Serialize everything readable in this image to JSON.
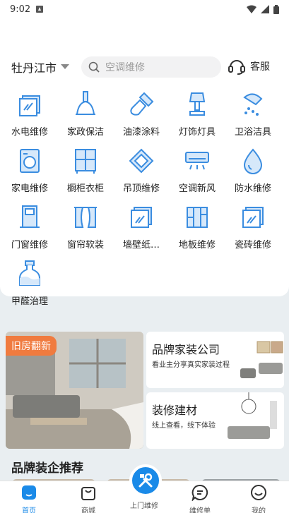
{
  "status": {
    "time": "9:02"
  },
  "header": {
    "city": "牡丹江市",
    "search_placeholder": "空调维修",
    "service_label": "客服"
  },
  "categories": [
    {
      "label": "水电维修",
      "icon": "water-electric-icon"
    },
    {
      "label": "家政保洁",
      "icon": "cleaning-icon"
    },
    {
      "label": "油漆涂料",
      "icon": "paint-brush-icon"
    },
    {
      "label": "灯饰灯具",
      "icon": "lamp-icon"
    },
    {
      "label": "卫浴洁具",
      "icon": "shower-icon"
    },
    {
      "label": "家电维修",
      "icon": "washing-machine-icon"
    },
    {
      "label": "橱柜衣柜",
      "icon": "wardrobe-icon"
    },
    {
      "label": "吊顶维修",
      "icon": "ceiling-icon"
    },
    {
      "label": "空调新风",
      "icon": "air-conditioner-icon"
    },
    {
      "label": "防水维修",
      "icon": "water-drop-icon"
    },
    {
      "label": "门窗维修",
      "icon": "door-icon"
    },
    {
      "label": "窗帘软装",
      "icon": "curtain-icon"
    },
    {
      "label": "墙壁纸…",
      "icon": "wallpaper-icon"
    },
    {
      "label": "地板维修",
      "icon": "floor-icon"
    },
    {
      "label": "瓷砖维修",
      "icon": "tile-icon"
    },
    {
      "label": "甲醛治理",
      "icon": "formaldehyde-icon"
    }
  ],
  "promo": {
    "renovation_tag": "旧房翻新",
    "card1": {
      "title": "品牌家装公司",
      "subtitle": "看业主分享真实家装过程"
    },
    "card2": {
      "title": "装修建材",
      "subtitle": "线上查看，线下体验"
    }
  },
  "recommend": {
    "title": "品牌装企推荐"
  },
  "tabbar": {
    "items": [
      {
        "label": "首页"
      },
      {
        "label": "商城"
      },
      {
        "label": "上门维修"
      },
      {
        "label": "维修单"
      },
      {
        "label": "我的"
      }
    ]
  },
  "colors": {
    "accent": "#1a8ae8",
    "tag": "#f07b3f",
    "icon_blue": "#3b8de0"
  }
}
